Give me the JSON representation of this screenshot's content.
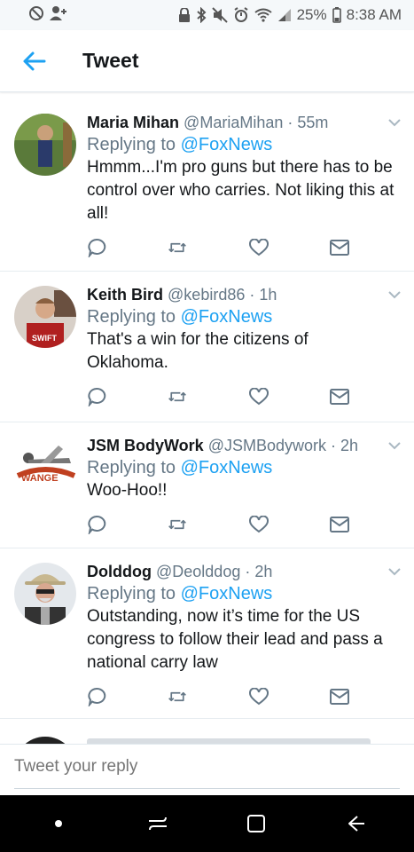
{
  "status_bar": {
    "battery": "25%",
    "time": "8:38 AM"
  },
  "header": {
    "title": "Tweet"
  },
  "tweets": [
    {
      "name": "Maria Mihan",
      "handle": "@MariaMihan",
      "time": "· 55m",
      "replying_prefix": "Replying to ",
      "replying_to": "@FoxNews",
      "text": "Hmmm...I'm pro guns but there has to be control over who carries. Not liking this at all!"
    },
    {
      "name": "Keith Bird",
      "handle": "@kebird86",
      "time": "· 1h",
      "replying_prefix": "Replying to ",
      "replying_to": "@FoxNews",
      "text": "That's a win for the citizens of Oklahoma."
    },
    {
      "name": "JSM BodyWork",
      "handle": "@JSMBodywork",
      "time": "· 2h",
      "replying_prefix": "Replying to ",
      "replying_to": "@FoxNews",
      "text": "Woo-Hoo!!"
    },
    {
      "name": "Dolddog",
      "handle": "@Deolddog",
      "time": "· 2h",
      "replying_prefix": "Replying to ",
      "replying_to": "@FoxNews",
      "text": "Outstanding, now it’s time for the US congress to follow their lead and pass a national carry law"
    }
  ],
  "reply_bar": {
    "placeholder": "Tweet your reply"
  },
  "icons": {
    "accent": "#1da1f2",
    "action_gray": "#657786"
  }
}
